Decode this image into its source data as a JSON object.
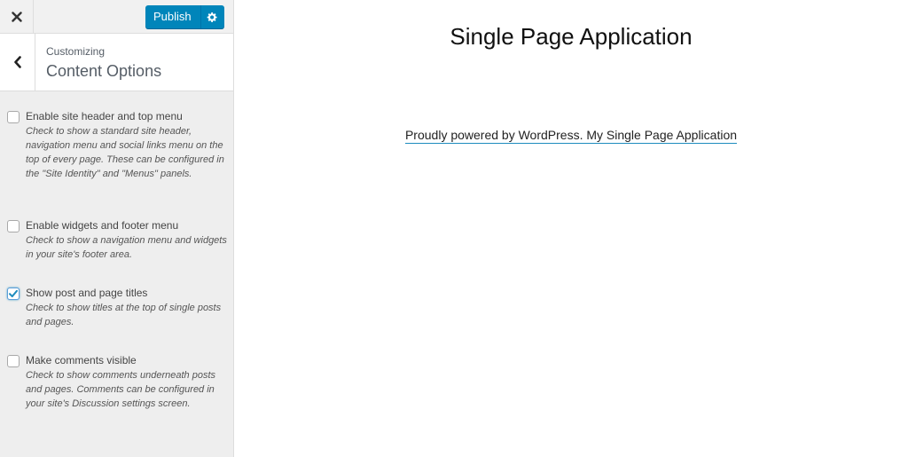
{
  "sidebar": {
    "close_icon": "close-icon",
    "publish_label": "Publish",
    "settings_icon": "gear-icon",
    "back_icon": "chevron-left-icon",
    "customizing_label": "Customizing",
    "section_title": "Content Options",
    "options": [
      {
        "label": "Enable site header and top menu",
        "description": "Check to show a standard site header, navigation menu and social links menu on the top of every page. These can be configured in the \"Site Identity\" and \"Menus\" panels.",
        "checked": false
      },
      {
        "label": "Enable widgets and footer menu",
        "description": "Check to show a navigation menu and widgets in your site's footer area.",
        "checked": false
      },
      {
        "label": "Show post and page titles",
        "description": "Check to show titles at the top of single posts and pages.",
        "checked": true
      },
      {
        "label": "Make comments visible",
        "description": "Check to show comments underneath posts and pages. Comments can be configured in your site's Discussion settings screen.",
        "checked": false
      }
    ]
  },
  "preview": {
    "site_title": "Single Page Application",
    "footer_link": "Proudly powered by WordPress. My Single Page Application"
  },
  "colors": {
    "accent": "#0085ba",
    "sidebar_bg": "#eeeeee",
    "link_underline": "#1e8cbe"
  }
}
